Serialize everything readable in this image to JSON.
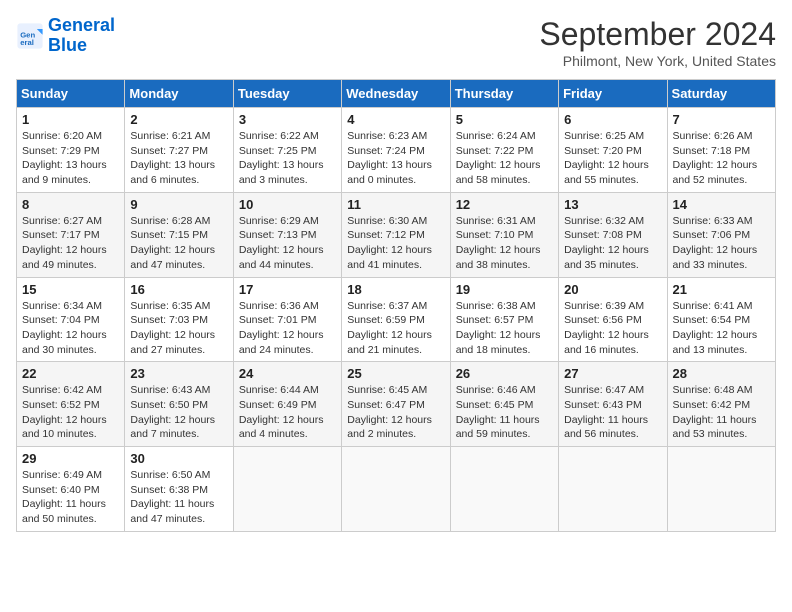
{
  "app": {
    "logo_line1": "General",
    "logo_line2": "Blue"
  },
  "header": {
    "title": "September 2024",
    "subtitle": "Philmont, New York, United States"
  },
  "calendar": {
    "columns": [
      "Sunday",
      "Monday",
      "Tuesday",
      "Wednesday",
      "Thursday",
      "Friday",
      "Saturday"
    ],
    "weeks": [
      [
        {
          "day": "1",
          "info": "Sunrise: 6:20 AM\nSunset: 7:29 PM\nDaylight: 13 hours and 9 minutes."
        },
        {
          "day": "2",
          "info": "Sunrise: 6:21 AM\nSunset: 7:27 PM\nDaylight: 13 hours and 6 minutes."
        },
        {
          "day": "3",
          "info": "Sunrise: 6:22 AM\nSunset: 7:25 PM\nDaylight: 13 hours and 3 minutes."
        },
        {
          "day": "4",
          "info": "Sunrise: 6:23 AM\nSunset: 7:24 PM\nDaylight: 13 hours and 0 minutes."
        },
        {
          "day": "5",
          "info": "Sunrise: 6:24 AM\nSunset: 7:22 PM\nDaylight: 12 hours and 58 minutes."
        },
        {
          "day": "6",
          "info": "Sunrise: 6:25 AM\nSunset: 7:20 PM\nDaylight: 12 hours and 55 minutes."
        },
        {
          "day": "7",
          "info": "Sunrise: 6:26 AM\nSunset: 7:18 PM\nDaylight: 12 hours and 52 minutes."
        }
      ],
      [
        {
          "day": "8",
          "info": "Sunrise: 6:27 AM\nSunset: 7:17 PM\nDaylight: 12 hours and 49 minutes."
        },
        {
          "day": "9",
          "info": "Sunrise: 6:28 AM\nSunset: 7:15 PM\nDaylight: 12 hours and 47 minutes."
        },
        {
          "day": "10",
          "info": "Sunrise: 6:29 AM\nSunset: 7:13 PM\nDaylight: 12 hours and 44 minutes."
        },
        {
          "day": "11",
          "info": "Sunrise: 6:30 AM\nSunset: 7:12 PM\nDaylight: 12 hours and 41 minutes."
        },
        {
          "day": "12",
          "info": "Sunrise: 6:31 AM\nSunset: 7:10 PM\nDaylight: 12 hours and 38 minutes."
        },
        {
          "day": "13",
          "info": "Sunrise: 6:32 AM\nSunset: 7:08 PM\nDaylight: 12 hours and 35 minutes."
        },
        {
          "day": "14",
          "info": "Sunrise: 6:33 AM\nSunset: 7:06 PM\nDaylight: 12 hours and 33 minutes."
        }
      ],
      [
        {
          "day": "15",
          "info": "Sunrise: 6:34 AM\nSunset: 7:04 PM\nDaylight: 12 hours and 30 minutes."
        },
        {
          "day": "16",
          "info": "Sunrise: 6:35 AM\nSunset: 7:03 PM\nDaylight: 12 hours and 27 minutes."
        },
        {
          "day": "17",
          "info": "Sunrise: 6:36 AM\nSunset: 7:01 PM\nDaylight: 12 hours and 24 minutes."
        },
        {
          "day": "18",
          "info": "Sunrise: 6:37 AM\nSunset: 6:59 PM\nDaylight: 12 hours and 21 minutes."
        },
        {
          "day": "19",
          "info": "Sunrise: 6:38 AM\nSunset: 6:57 PM\nDaylight: 12 hours and 18 minutes."
        },
        {
          "day": "20",
          "info": "Sunrise: 6:39 AM\nSunset: 6:56 PM\nDaylight: 12 hours and 16 minutes."
        },
        {
          "day": "21",
          "info": "Sunrise: 6:41 AM\nSunset: 6:54 PM\nDaylight: 12 hours and 13 minutes."
        }
      ],
      [
        {
          "day": "22",
          "info": "Sunrise: 6:42 AM\nSunset: 6:52 PM\nDaylight: 12 hours and 10 minutes."
        },
        {
          "day": "23",
          "info": "Sunrise: 6:43 AM\nSunset: 6:50 PM\nDaylight: 12 hours and 7 minutes."
        },
        {
          "day": "24",
          "info": "Sunrise: 6:44 AM\nSunset: 6:49 PM\nDaylight: 12 hours and 4 minutes."
        },
        {
          "day": "25",
          "info": "Sunrise: 6:45 AM\nSunset: 6:47 PM\nDaylight: 12 hours and 2 minutes."
        },
        {
          "day": "26",
          "info": "Sunrise: 6:46 AM\nSunset: 6:45 PM\nDaylight: 11 hours and 59 minutes."
        },
        {
          "day": "27",
          "info": "Sunrise: 6:47 AM\nSunset: 6:43 PM\nDaylight: 11 hours and 56 minutes."
        },
        {
          "day": "28",
          "info": "Sunrise: 6:48 AM\nSunset: 6:42 PM\nDaylight: 11 hours and 53 minutes."
        }
      ],
      [
        {
          "day": "29",
          "info": "Sunrise: 6:49 AM\nSunset: 6:40 PM\nDaylight: 11 hours and 50 minutes."
        },
        {
          "day": "30",
          "info": "Sunrise: 6:50 AM\nSunset: 6:38 PM\nDaylight: 11 hours and 47 minutes."
        },
        null,
        null,
        null,
        null,
        null
      ]
    ]
  }
}
